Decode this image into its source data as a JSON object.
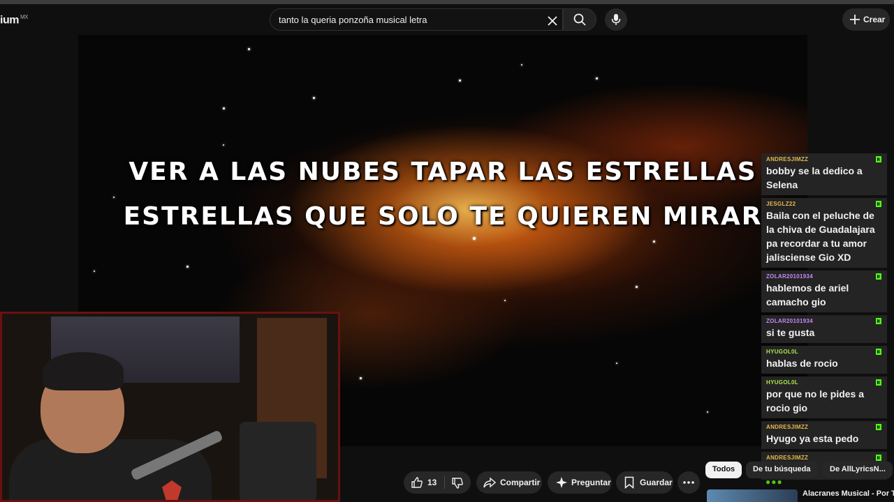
{
  "header": {
    "logo_text": "ium",
    "logo_region": "MX",
    "search_value": "tanto la queria ponzoña musical letra",
    "create_label": "Crear"
  },
  "video": {
    "lyric_line_1": "VER A LAS NUBES TAPAR LAS ESTRELLAS",
    "lyric_line_2": "ESTRELLAS QUE SOLO TE QUIEREN MIRAR"
  },
  "chat": {
    "messages": [
      {
        "user": "ANDRESJIMZZ",
        "user_color": "#e8b84a",
        "text": "bobby se la dedico a Selena"
      },
      {
        "user": "JESGLZ22",
        "user_color": "#e8b84a",
        "text": "Baila con el peluche de la chiva de Guadalajara pa recordar a tu amor jalisciense Gio XD"
      },
      {
        "user": "ZOLAR20101934",
        "user_color": "#c58af9",
        "text": "hablemos de ariel camacho gio"
      },
      {
        "user": "ZOLAR20101934",
        "user_color": "#c58af9",
        "text": "si te gusta"
      },
      {
        "user": "HYUGOL0L",
        "user_color": "#a8e84a",
        "text": "hablas de rocio"
      },
      {
        "user": "HYUGOL0L",
        "user_color": "#a8e84a",
        "text": "por que no le pides a rocio gio"
      },
      {
        "user": "ANDRESJIMZZ",
        "user_color": "#e8b84a",
        "text": "Hyugo ya esta pedo"
      },
      {
        "user": "ANDRESJIMZZ",
        "user_color": "#e8b84a",
        "text": ""
      }
    ]
  },
  "actions": {
    "like_count": "13",
    "share_label": "Compartir",
    "ask_label": "Preguntar",
    "save_label": "Guardar"
  },
  "chips": {
    "all": "Todos",
    "search": "De tu búsqueda",
    "channel": "De AllLyricsN..."
  },
  "recommendation": {
    "title": "Alacranes Musical - Por Tu"
  },
  "colors": {
    "kick_badge": "#53fc18",
    "webcam_border": "#6b1010"
  }
}
